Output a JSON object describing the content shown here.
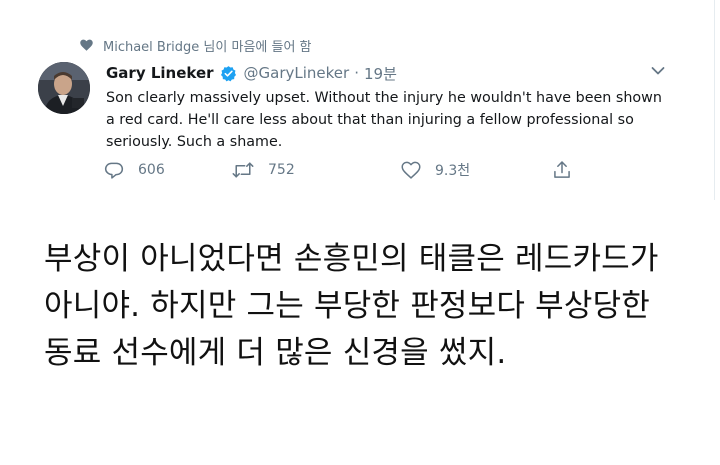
{
  "liked_by": {
    "text": "Michael Bridge 님이 마음에 들어 함",
    "icon": "heart-icon"
  },
  "tweet": {
    "display_name": "Gary Lineker",
    "verified": true,
    "handle": "@GaryLineker",
    "separator": "·",
    "time": "19분",
    "text": "Son clearly massively upset. Without the injury he wouldn't have been shown a red card. He'll care less about that than injuring a fellow professional so seriously. Such a shame.",
    "actions": {
      "reply_count": "606",
      "retweet_count": "752",
      "like_count": "9.3천"
    }
  },
  "caption": {
    "lines": [
      "부상이 아니었다면 손흥민의 태클은 레드카드가",
      "아니야. 하지만 그는 부당한 판정보다 부상당한",
      "동료 선수에게 더 많은 신경을 썼지."
    ]
  },
  "colors": {
    "muted": "#657786",
    "text": "#14171a",
    "verified": "#1da1f2"
  }
}
